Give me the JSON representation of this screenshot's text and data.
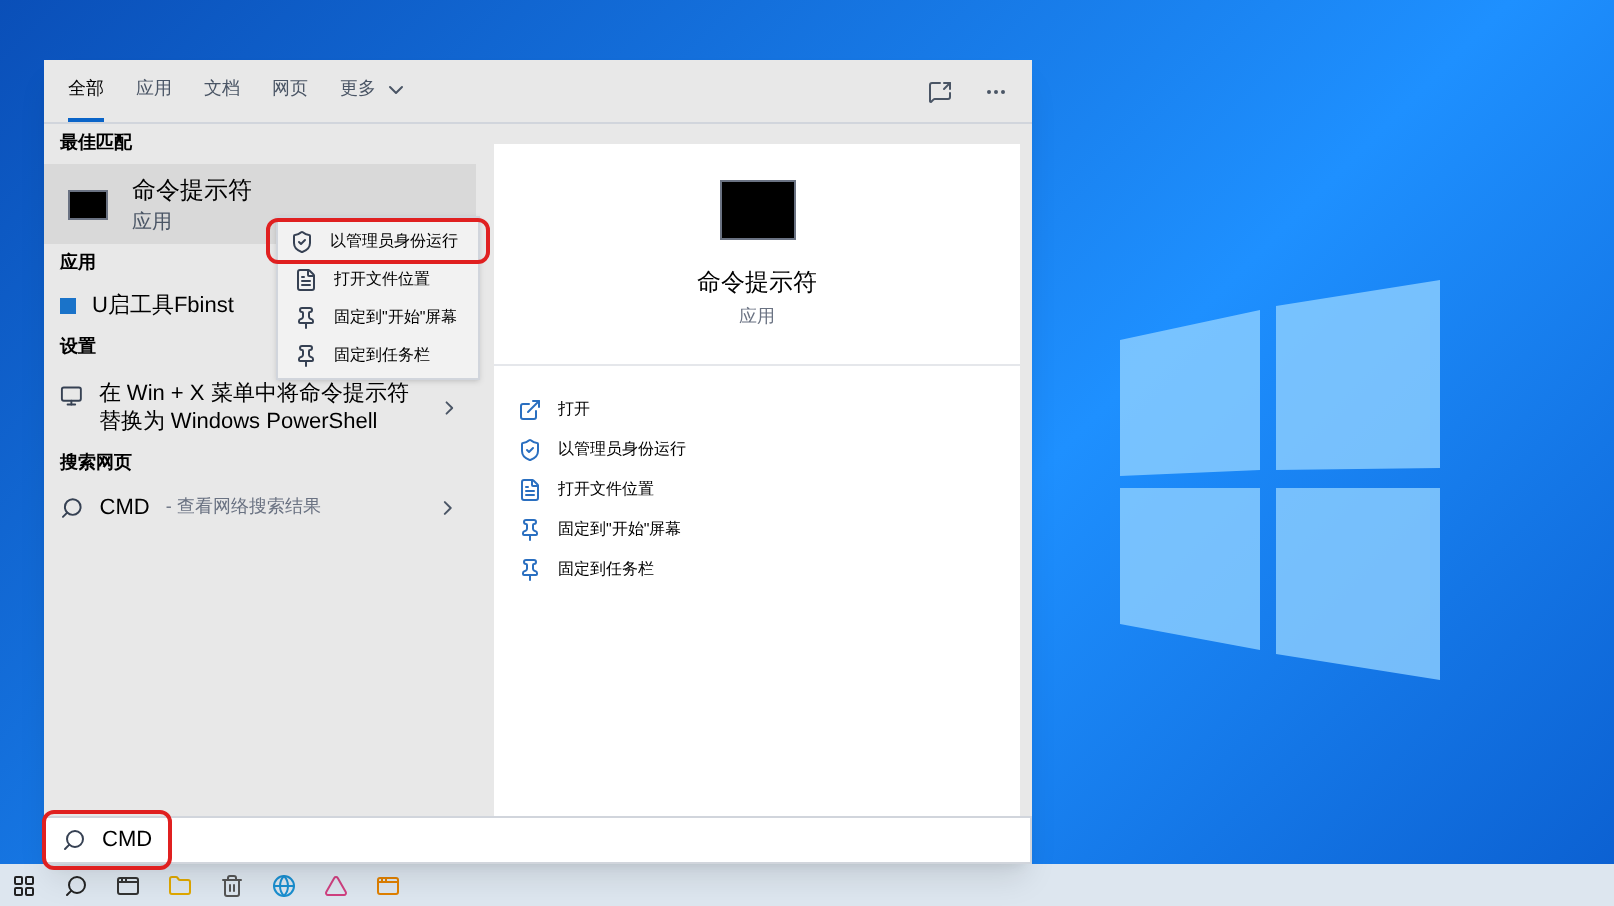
{
  "tabs": [
    {
      "label": "全部",
      "selected": true,
      "kind": "plain"
    },
    {
      "label": "应用",
      "selected": false,
      "kind": "plain"
    },
    {
      "label": "文档",
      "selected": false,
      "kind": "plain"
    },
    {
      "label": "网页",
      "selected": false,
      "kind": "plain"
    },
    {
      "label": "更多",
      "selected": false,
      "kind": "dropdown"
    }
  ],
  "sections": [
    {
      "heading": "最佳匹配",
      "items": [
        {
          "kind": "best",
          "title": "命令提示符",
          "subtitle": "应用",
          "selected": true
        }
      ]
    },
    {
      "heading": "应用",
      "items": [
        {
          "kind": "app",
          "title": "U启工具Fbinst",
          "selected": false
        }
      ]
    },
    {
      "heading": "设置",
      "items": [
        {
          "kind": "setting",
          "title": "在 Win + X 菜单中将命令提示符替换为 Windows PowerShell",
          "selected": false
        }
      ]
    },
    {
      "heading": "搜索网页",
      "items": [
        {
          "kind": "web",
          "title": "CMD",
          "subtitle": "- 查看网络搜索结果",
          "selected": false
        }
      ]
    }
  ],
  "context_menu": [
    {
      "kind": "admin",
      "label": "以管理员身份运行",
      "highlighted": true
    },
    {
      "kind": "folder",
      "label": "打开文件位置",
      "highlighted": false
    },
    {
      "kind": "pin",
      "label": "固定到\"开始\"屏幕",
      "highlighted": false
    },
    {
      "kind": "pin",
      "label": "固定到任务栏",
      "highlighted": false
    }
  ],
  "preview": {
    "title": "命令提示符",
    "subtitle": "应用",
    "actions": [
      {
        "kind": "open",
        "label": "打开"
      },
      {
        "kind": "admin",
        "label": "以管理员身份运行"
      },
      {
        "kind": "folder",
        "label": "打开文件位置"
      },
      {
        "kind": "pin",
        "label": "固定到\"开始\"屏幕"
      },
      {
        "kind": "pin",
        "label": "固定到任务栏"
      }
    ]
  },
  "search": {
    "value": "CMD",
    "highlighted": true
  }
}
